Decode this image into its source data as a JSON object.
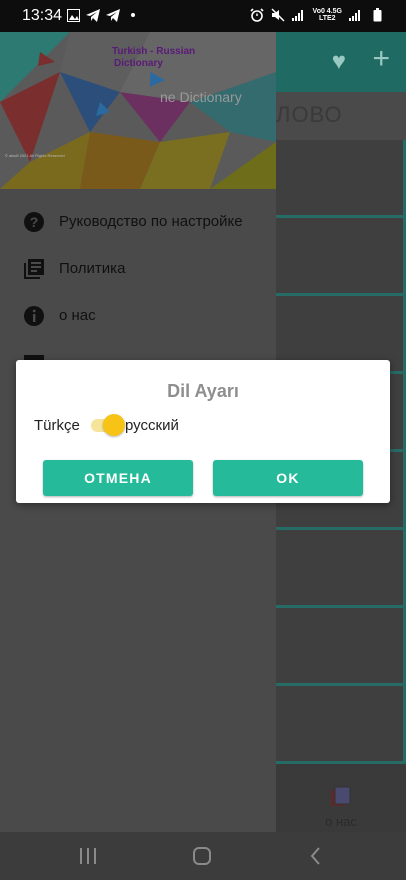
{
  "status_bar": {
    "time": "13:34",
    "network_top": "Vo0 4.5G",
    "network_bottom": "LTE2"
  },
  "app": {
    "search_text": "ЛОВО",
    "bottom_tab_label": "о нас"
  },
  "drawer": {
    "header_title_line1": "Turkish - Russian",
    "header_title_line2": "Dictionary",
    "header_subtitle": "ne Dictionary",
    "header_copyright": "© aisoft 2021 All Rights Reserved",
    "items": [
      {
        "label": "Руководство по настройке",
        "icon": "help-circle-icon"
      },
      {
        "label": "Политика",
        "icon": "library-books-icon"
      },
      {
        "label": "о нас",
        "icon": "info-icon"
      }
    ]
  },
  "dialog": {
    "title": "Dil Ayarı",
    "left_language": "Türkçe",
    "right_language": "русский",
    "switch_on": true,
    "cancel_label": "ОТМЕНА",
    "ok_label": "OK"
  },
  "colors": {
    "accent": "#25bb9a",
    "switch_thumb": "#f7c314",
    "toolbar_dim": "#1f6b63"
  }
}
